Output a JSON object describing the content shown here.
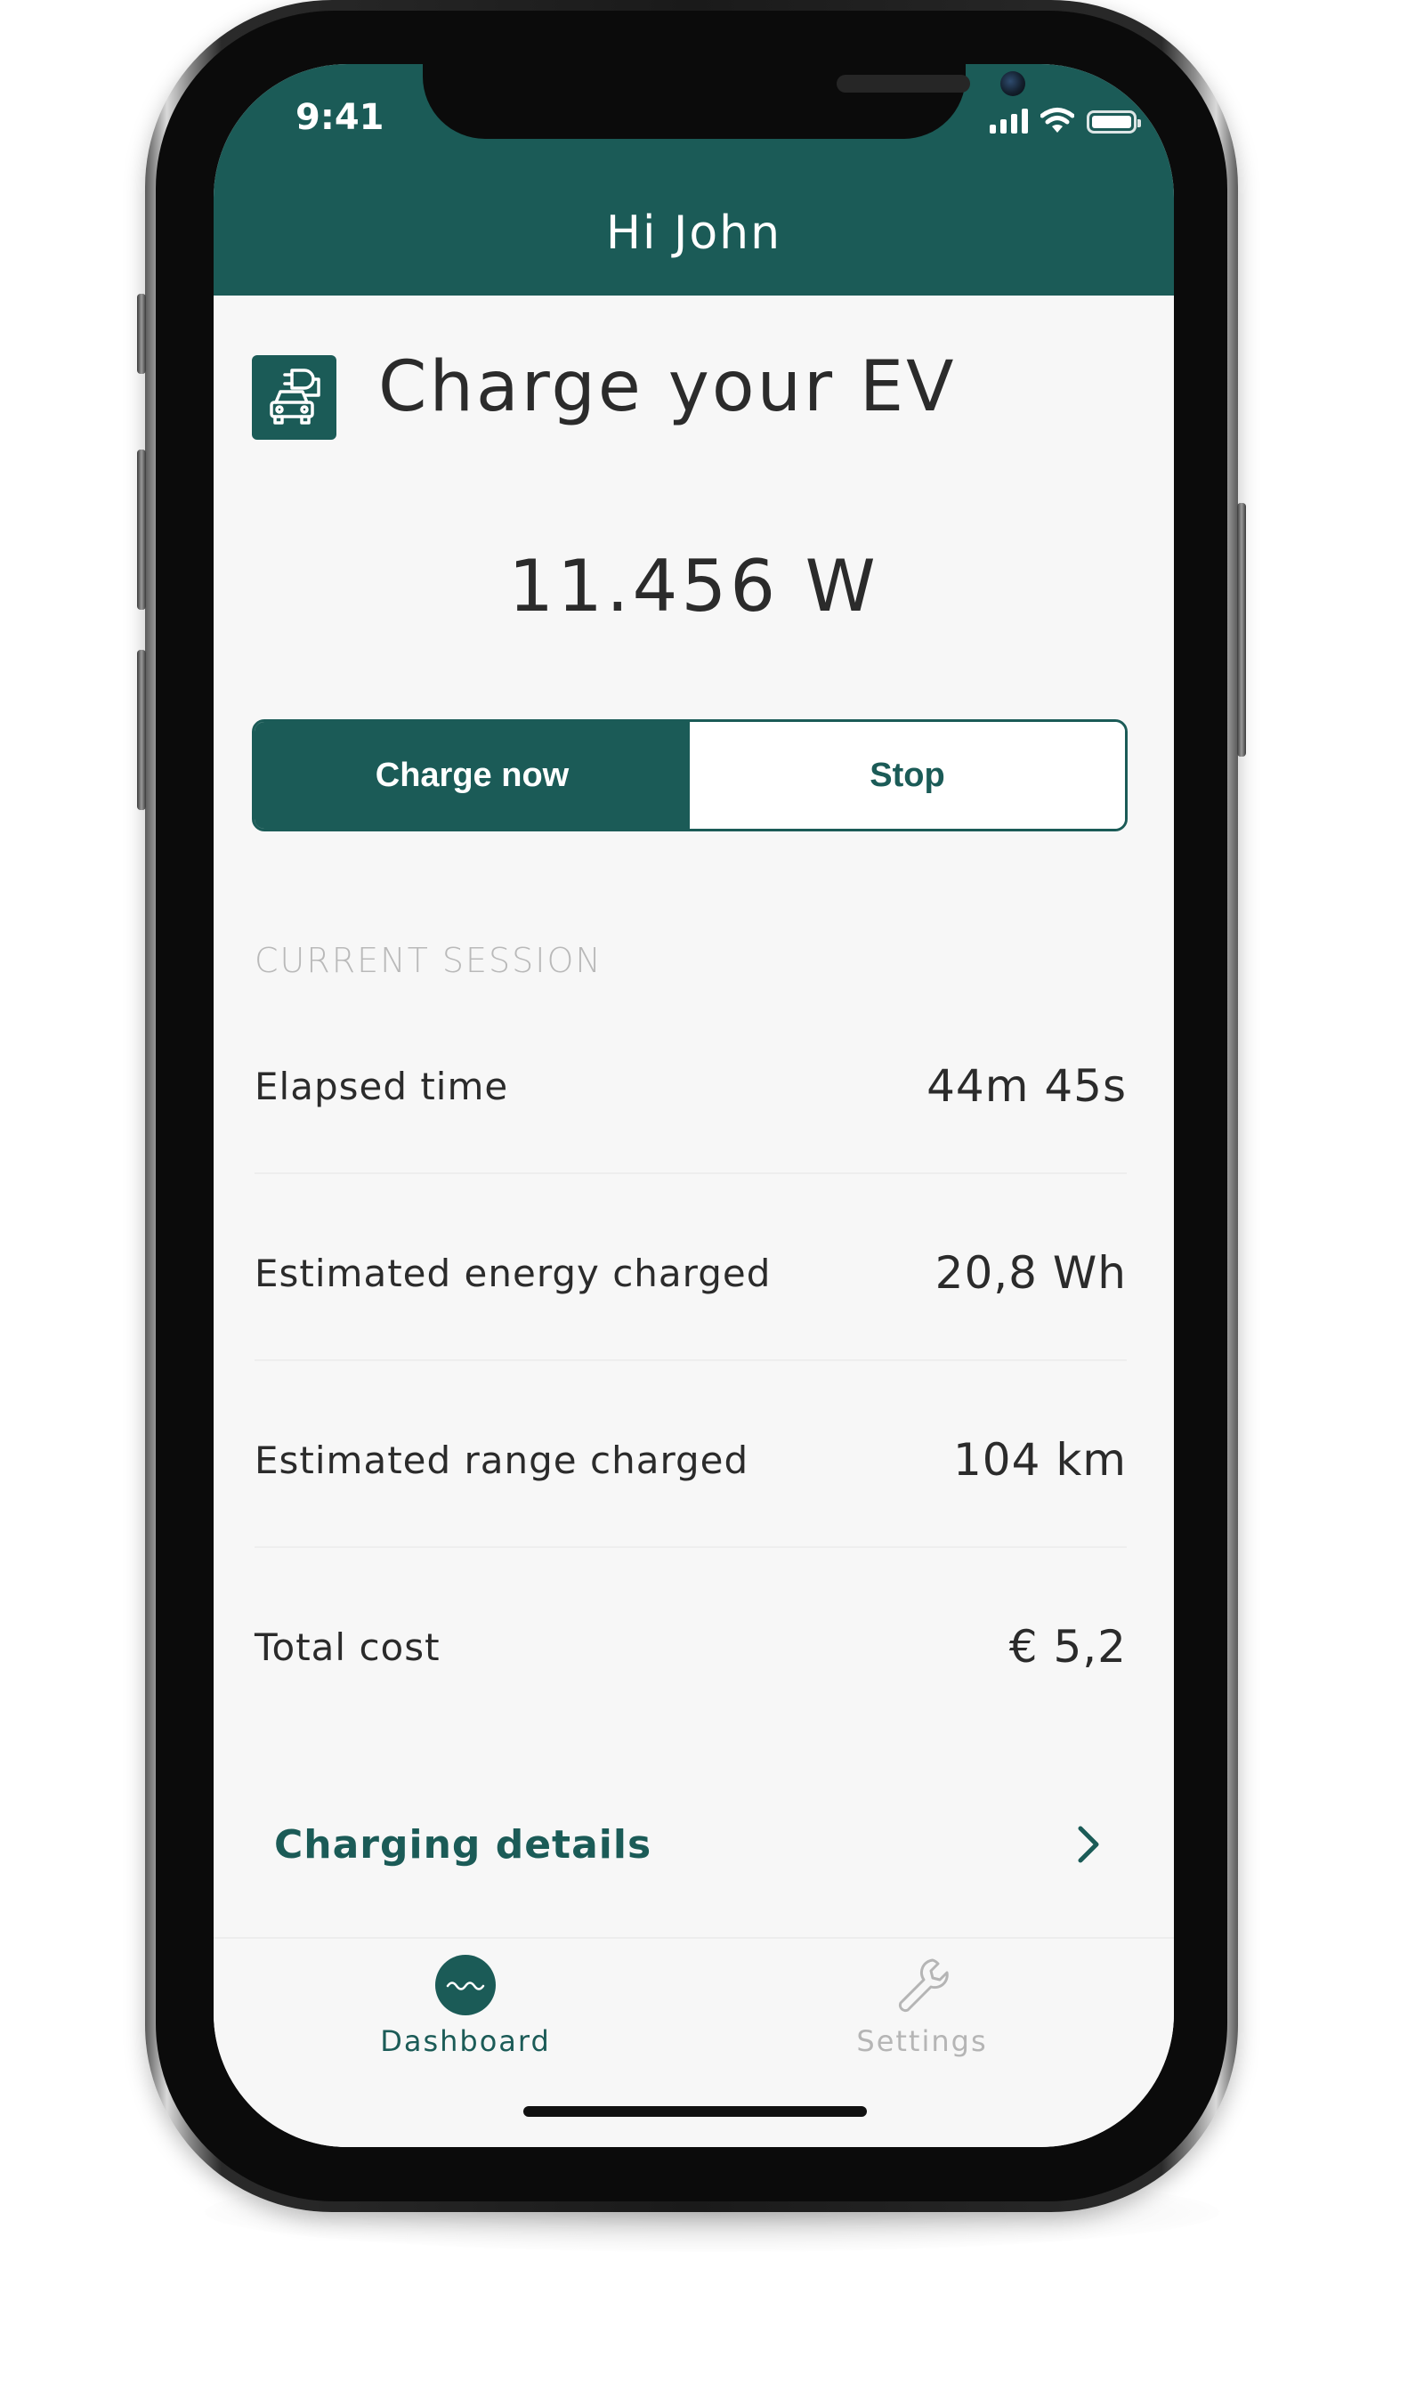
{
  "status_bar": {
    "time": "9:41"
  },
  "header": {
    "greeting": "Hi John"
  },
  "main": {
    "title": "Charge your EV",
    "title_icon": "ev-charging-car-icon",
    "power_reading": "11.456 W",
    "actions": {
      "charge_now_label": "Charge now",
      "stop_label": "Stop"
    },
    "session": {
      "heading": "CURRENT SESSION",
      "rows": [
        {
          "label": "Elapsed time",
          "value": "44m 45s"
        },
        {
          "label": "Estimated energy charged",
          "value": "20,8 Wh"
        },
        {
          "label": "Estimated range charged",
          "value": "104 km"
        },
        {
          "label": "Total cost",
          "value": "€ 5,2"
        }
      ]
    },
    "details_link": {
      "label": "Charging details",
      "icon": "chevron-right-icon"
    }
  },
  "tab_bar": {
    "tabs": [
      {
        "label": "Dashboard",
        "icon": "wave-icon",
        "active": true
      },
      {
        "label": "Settings",
        "icon": "wrench-icon",
        "active": false
      }
    ]
  },
  "colors": {
    "brand": "#1b5b57",
    "text": "#2b2b2b",
    "muted": "#b9b9b9",
    "background": "#f7f7f7"
  }
}
